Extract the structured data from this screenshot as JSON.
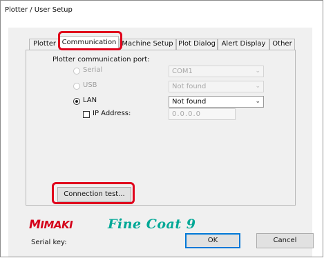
{
  "window": {
    "title": "Plotter / User Setup"
  },
  "tabs": [
    {
      "label": "Plotter",
      "active": false
    },
    {
      "label": "Communication",
      "active": true
    },
    {
      "label": "Machine Setup",
      "active": false
    },
    {
      "label": "Plot Dialog",
      "active": false
    },
    {
      "label": "Alert Display",
      "active": false
    },
    {
      "label": "Other",
      "active": false
    }
  ],
  "communication": {
    "port_label": "Plotter communication port:",
    "options": [
      {
        "label": "Serial",
        "selected": false,
        "enabled": false,
        "value": "COM1"
      },
      {
        "label": "USB",
        "selected": false,
        "enabled": false,
        "value": "Not found"
      },
      {
        "label": "LAN",
        "selected": true,
        "enabled": true,
        "value": "Not found"
      }
    ],
    "ip": {
      "label": "IP Address:",
      "checked": false,
      "value": "0.0.0.0"
    },
    "connection_test_label": "Connection test..."
  },
  "branding": {
    "maker_logo": "MIMAKI",
    "product_logo": "FineCoat9",
    "brand_red": "#d4001a",
    "brand_teal": "#00a896"
  },
  "footer": {
    "serial_key_label": "Serial key:",
    "ok_label": "OK",
    "cancel_label": "Cancel"
  },
  "annotations": {
    "highlight_color": "#e0001b"
  }
}
